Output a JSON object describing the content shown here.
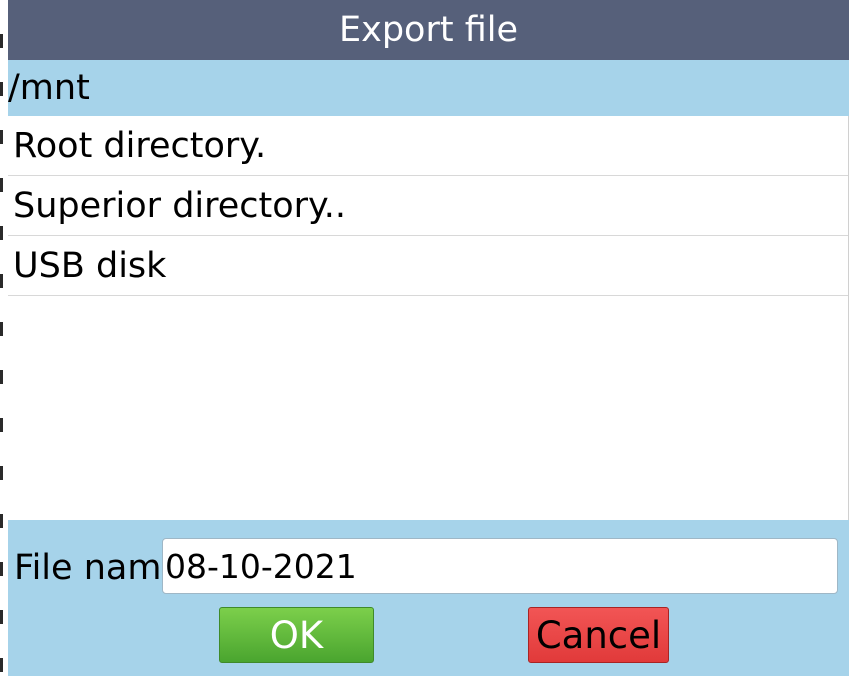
{
  "dialog": {
    "title": "Export file",
    "current_path": "/mnt",
    "items": [
      {
        "label": "Root directory."
      },
      {
        "label": "Superior directory.."
      },
      {
        "label": "USB disk"
      }
    ],
    "filename_label": "File name",
    "filename_value": "08-10-2021",
    "ok_label": "OK",
    "cancel_label": "Cancel"
  },
  "colors": {
    "title_bar": "#56607a",
    "panel": "#a6d3ea",
    "ok_button": "#4aa52f",
    "cancel_button": "#e13a3a"
  }
}
